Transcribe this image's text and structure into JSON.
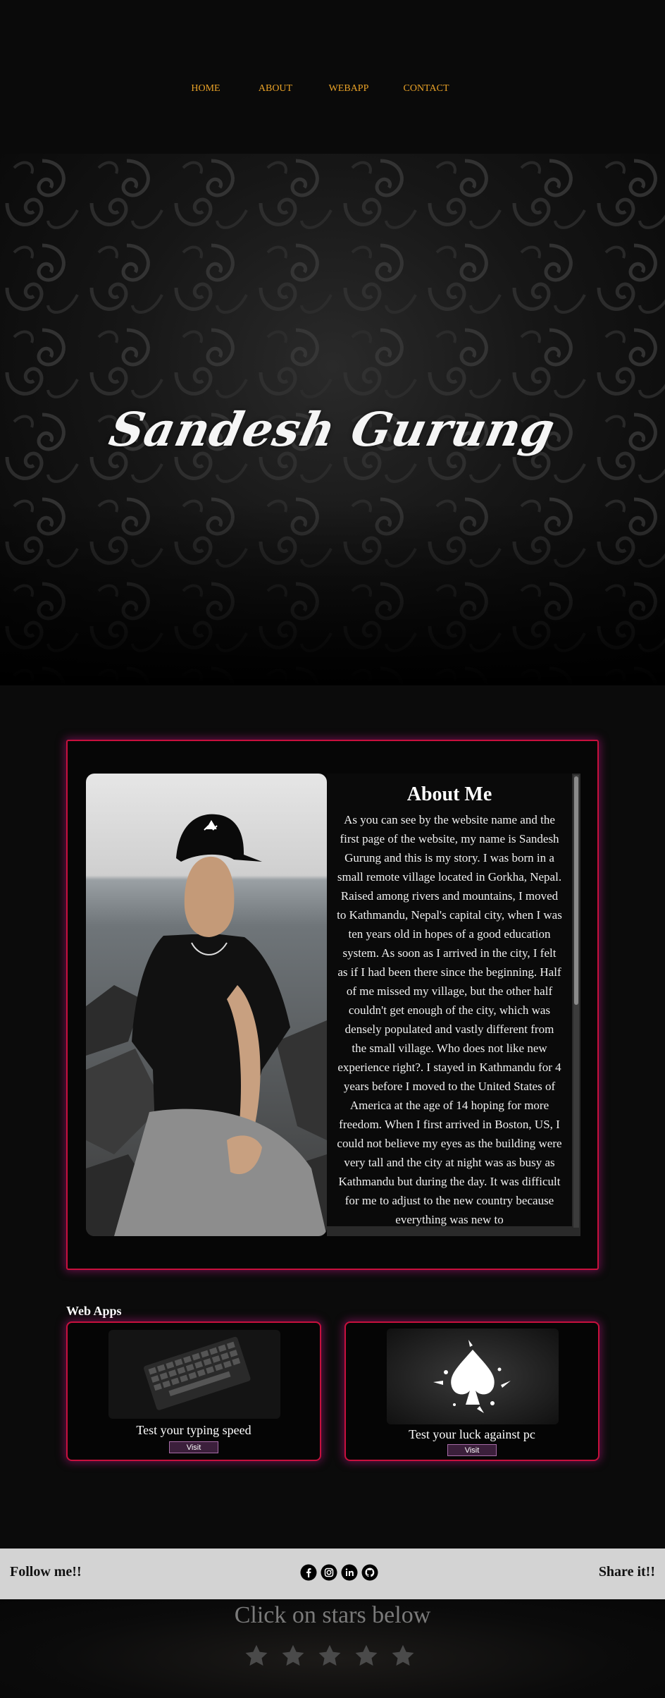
{
  "nav": {
    "items": [
      {
        "label": "HOME"
      },
      {
        "label": "ABOUT"
      },
      {
        "label": "WEBAPP"
      },
      {
        "label": "CONTACT"
      }
    ],
    "link_color": "#e9a227"
  },
  "hero": {
    "title": "Sandesh Gurung"
  },
  "about": {
    "heading": "About Me",
    "text": "As you can see by the website name and the first page of the website, my name is Sandesh Gurung and this is my story. I was born in a small remote village located in Gorkha, Nepal. Raised among rivers and mountains, I moved to Kathmandu, Nepal's capital city, when I was ten years old in hopes of a good education system. As soon as I arrived in the city, I felt as if I had been there since the beginning. Half of me missed my village, but the other half couldn't get enough of the city, which was densely populated and vastly different from the small village. Who does not like new experience right?. I stayed in Kathmandu for 4 years before I moved to the United States of America at the age of 14 hoping for more freedom. When I first arrived in Boston, US, I could not believe my eyes as the building were very tall and the city at night was as busy as Kathmandu but during the day. It was difficult for me to adjust to the new country because everything was new to"
  },
  "webapps": {
    "title": "Web Apps",
    "cards": [
      {
        "label": "Test your typing speed",
        "button": "Visit",
        "image": "keyboard-image"
      },
      {
        "label": "Test your luck against pc",
        "button": "Visit",
        "image": "spade-card-image"
      }
    ]
  },
  "footer": {
    "follow": "Follow me!!",
    "share": "Share it!!",
    "social": [
      "facebook-icon",
      "instagram-icon",
      "linkedin-icon",
      "github-icon"
    ]
  },
  "rating": {
    "prompt": "Click on stars below",
    "stars": 5
  },
  "colors": {
    "accent_border": "#c8103d",
    "glow": "#aa1478",
    "footer_bg": "#d3d3d3"
  }
}
